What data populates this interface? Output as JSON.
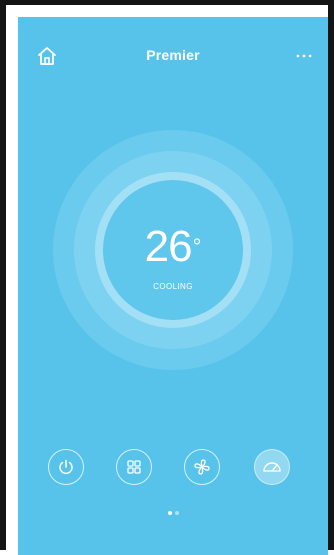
{
  "header": {
    "title": "Premier",
    "home_icon": "home-icon",
    "more_icon": "more-icon"
  },
  "thermostat": {
    "temperature": "26",
    "unit": "°",
    "mode": "COOLING"
  },
  "controls": [
    {
      "name": "power",
      "icon": "power-icon",
      "active": false
    },
    {
      "name": "mode",
      "icon": "grid-icon",
      "active": false
    },
    {
      "name": "fan",
      "icon": "fan-icon",
      "active": false
    },
    {
      "name": "speed",
      "icon": "speedometer-icon",
      "active": true
    }
  ],
  "pager": {
    "total": 2,
    "current": 1
  },
  "colors": {
    "background": "#58c3ea",
    "foreground": "#ffffff",
    "frame": "#141414"
  }
}
